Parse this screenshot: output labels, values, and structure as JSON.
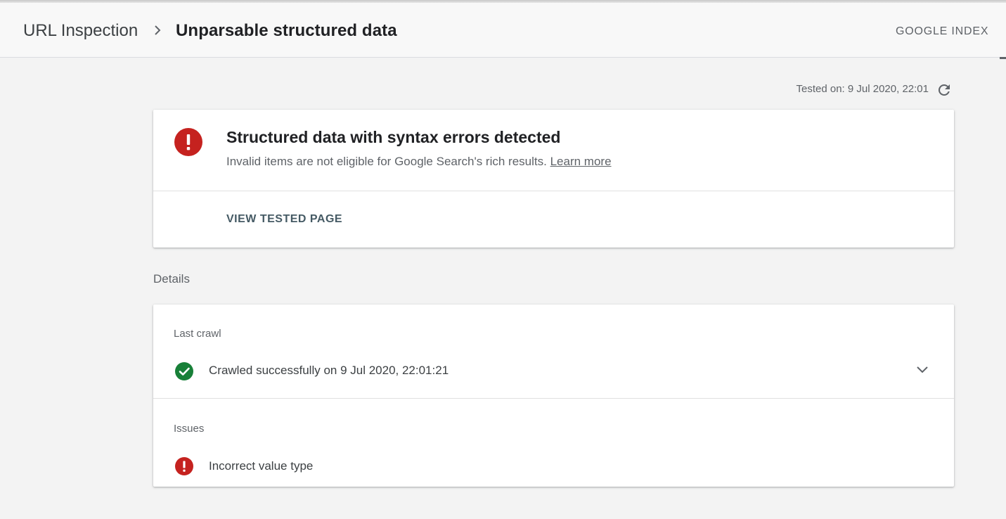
{
  "header": {
    "breadcrumb_root": "URL Inspection",
    "breadcrumb_current": "Unparsable structured data",
    "tab_label": "GOOGLE INDEX"
  },
  "test": {
    "tested_on": "Tested on: 9 Jul 2020, 22:01"
  },
  "summary_card": {
    "title": "Structured data with syntax errors detected",
    "subtitle": "Invalid items are not eligible for Google Search's rich results.",
    "learn_more": "Learn more",
    "action": "VIEW TESTED PAGE",
    "status_icon": "error-icon"
  },
  "details": {
    "label": "Details",
    "last_crawl": {
      "label": "Last crawl",
      "text": "Crawled successfully on 9 Jul 2020, 22:01:21",
      "icon": "check-circle-icon"
    },
    "issues": {
      "label": "Issues",
      "text": "Incorrect value type",
      "icon": "error-icon"
    }
  },
  "colors": {
    "error": "#c5221f",
    "success": "#188038",
    "button_text": "#455a64"
  }
}
